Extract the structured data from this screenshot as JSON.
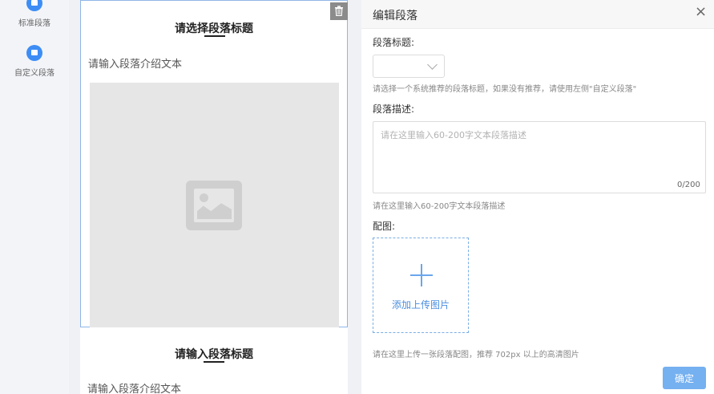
{
  "palette": {
    "items": [
      {
        "label": "标准段落",
        "icon": "paragraph-icon"
      },
      {
        "label": "自定义段落",
        "icon": "custom-paragraph-icon"
      }
    ]
  },
  "preview": {
    "blocks": [
      {
        "title": "请选择段落标题",
        "desc": "请输入段落介绍文本"
      },
      {
        "title": "请输入段落标题",
        "desc": "请输入段落介绍文本"
      }
    ],
    "delete_icon": "trash-icon"
  },
  "panel": {
    "title": "编辑段落",
    "close_glyph": "×",
    "title_field": {
      "label": "段落标题:",
      "selected": "",
      "hint": "请选择一个系统推荐的段落标题，如果没有推荐，请使用左侧\"自定义段落\""
    },
    "desc_field": {
      "label": "段落描述:",
      "placeholder": "请在这里输入60-200字文本段落描述",
      "value": "",
      "counter": "0/200",
      "hint": "请在这里输入60-200字文本段落描述"
    },
    "image_field": {
      "label": "配图:",
      "upload_label": "添加上传图片",
      "hint": "请在这里上传一张段落配图，推荐 702px 以上的高清图片"
    },
    "confirm_label": "确定"
  },
  "colors": {
    "accent": "#3d8df5",
    "button": "#75b0f0",
    "selected_border": "#8fb6e8"
  }
}
